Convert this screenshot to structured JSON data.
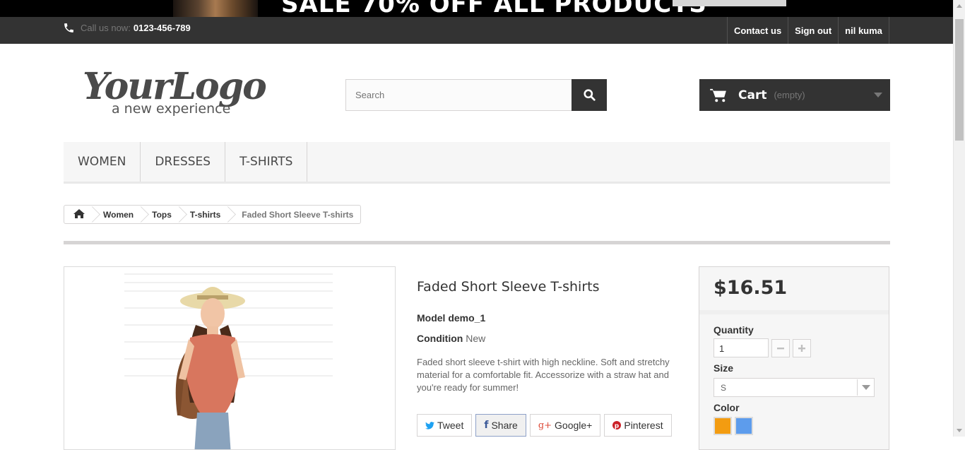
{
  "banner": {
    "text": "SALE 70% OFF ALL PRODUCTS"
  },
  "topnav": {
    "call_label": "Call us now:",
    "phone": "0123-456-789",
    "links": [
      "Contact us",
      "Sign out",
      "nil kuma"
    ]
  },
  "header": {
    "logo_main": "YourLogo",
    "logo_tag": "a new experience",
    "search_placeholder": "Search",
    "cart_label": "Cart",
    "cart_status": "(empty)"
  },
  "menu": {
    "items": [
      "Women",
      "Dresses",
      "T-shirts"
    ]
  },
  "breadcrumb": {
    "items": [
      "Women",
      "Tops",
      "T-shirts"
    ],
    "current": "Faded Short Sleeve T-shirts"
  },
  "product": {
    "title": "Faded Short Sleeve T-shirts",
    "model_label": "Model",
    "model": "demo_1",
    "condition_label": "Condition",
    "condition": "New",
    "description": "Faded short sleeve t-shirt with high neckline. Soft and stretchy material for a comfortable fit. Accessorize with a straw hat and you're ready for summer!"
  },
  "social": {
    "tweet": "Tweet",
    "share": "Share",
    "google": "Google+",
    "pinterest": "Pinterest"
  },
  "buy": {
    "price": "$16.51",
    "quantity_label": "Quantity",
    "quantity": "1",
    "size_label": "Size",
    "size": "S",
    "color_label": "Color",
    "colors": [
      "#f39c11",
      "#5d9cec"
    ]
  }
}
